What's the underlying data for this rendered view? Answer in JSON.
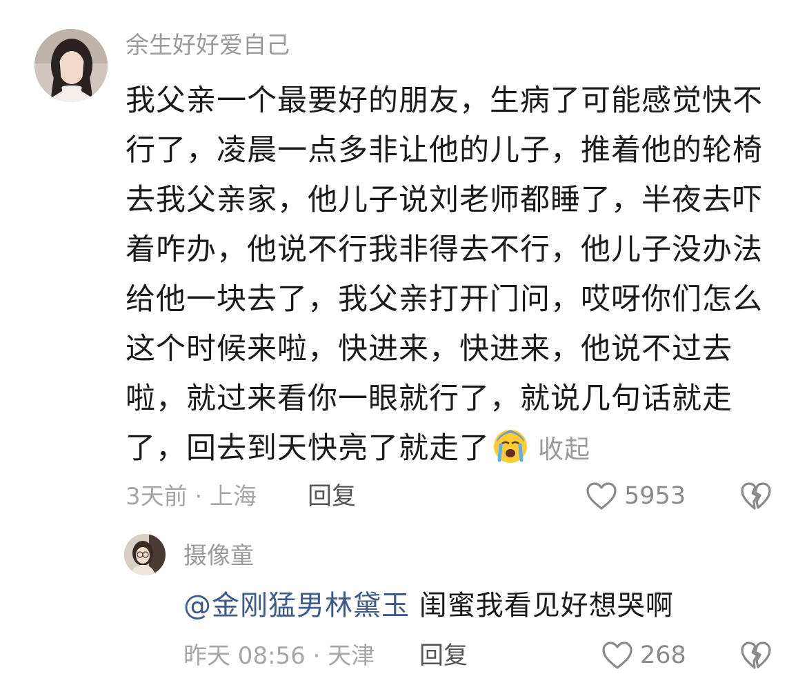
{
  "comment": {
    "username": "余生好好爱自己",
    "body_lines": [
      "我父亲一个最要好的朋友，生病了可能感觉快不",
      "行了，凌晨一点多非让他的儿子，推着他的轮椅",
      "去我父亲家，他儿子说刘老师都睡了，半夜去吓",
      "着咋办，他说不行我非得去不行，他儿子没办法",
      "给他一块去了，我父亲打开门问，哎呀你们怎么",
      "这个时候来啦，快进来，快进来，他说不过去",
      "啦，就过来看你一眼就行了，就说几句话就走",
      "了，回去到天快亮了就走了"
    ],
    "emoji": "crying-face",
    "collapse_label": "收起",
    "meta": "3天前 · 上海",
    "reply_label": "回复",
    "like_count": "5953"
  },
  "reply": {
    "username": "摄像童",
    "mention": "@金刚猛男林黛玉",
    "text": " 闺蜜我看见好想哭啊",
    "meta": "昨天 08:56 · 天津",
    "reply_label": "回复",
    "like_count": "268"
  },
  "colors": {
    "username": "#9a9a9a",
    "body": "#1a1a1a",
    "meta": "#a6a6a6",
    "mention": "#3c5a8a",
    "icon": "#8a8a8a"
  }
}
